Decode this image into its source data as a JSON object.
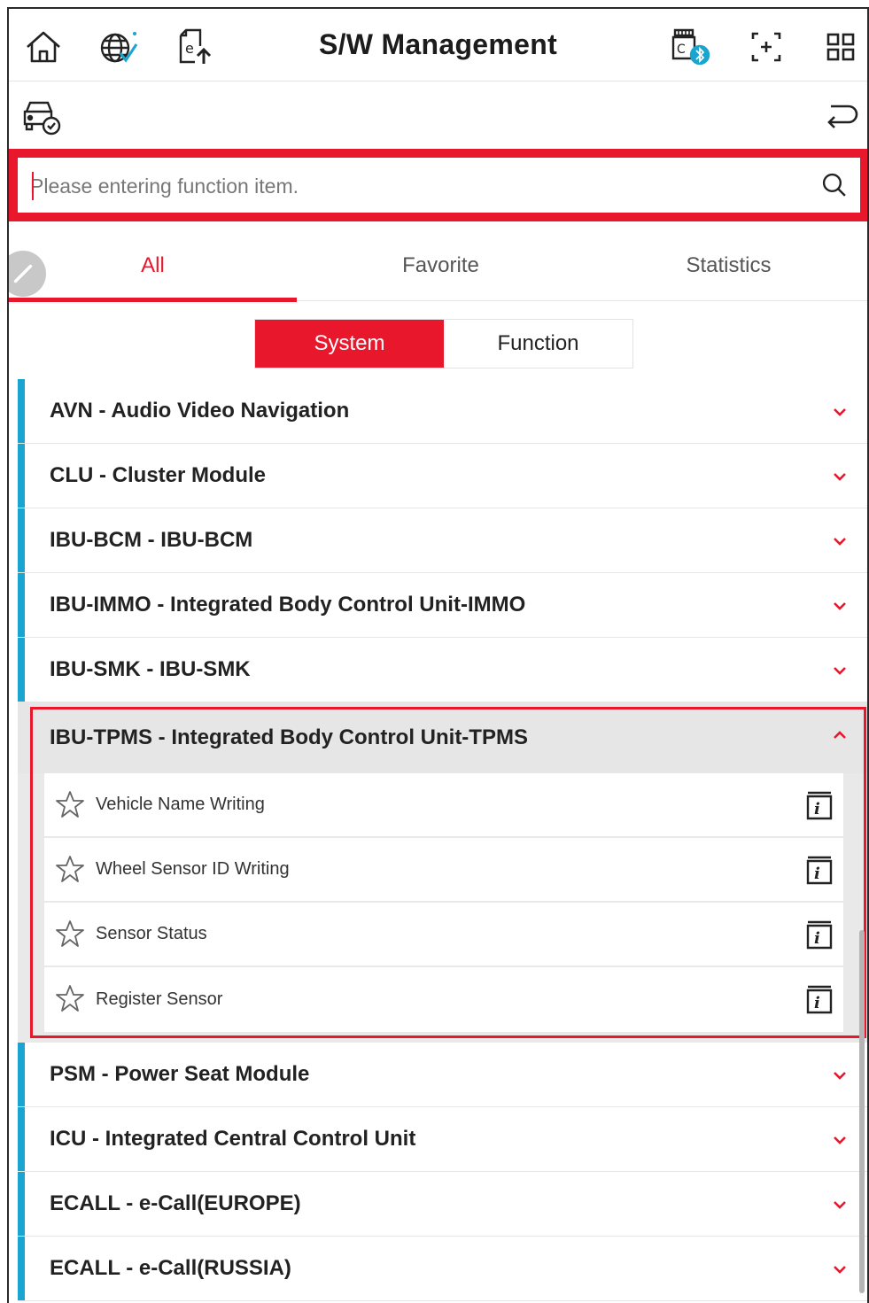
{
  "header": {
    "title": "S/W Management",
    "icons": [
      "home-icon",
      "globe-check-icon",
      "e-upload-icon",
      "vci-bluetooth-icon",
      "screenshot-icon",
      "grid-menu-icon"
    ]
  },
  "subbar": {
    "icons": [
      "vehicle-check-icon",
      "return-icon"
    ]
  },
  "search": {
    "placeholder": "Please entering function item."
  },
  "tabs": [
    {
      "label": "All",
      "active": true
    },
    {
      "label": "Favorite",
      "active": false
    },
    {
      "label": "Statistics",
      "active": false
    }
  ],
  "segment": [
    {
      "label": "System",
      "active": true
    },
    {
      "label": "Function",
      "active": false
    }
  ],
  "systems": [
    {
      "label": "AVN - Audio Video Navigation"
    },
    {
      "label": "CLU - Cluster Module"
    },
    {
      "label": "IBU-BCM - IBU-BCM"
    },
    {
      "label": "IBU-IMMO - Integrated Body Control Unit-IMMO"
    },
    {
      "label": "IBU-SMK - IBU-SMK"
    },
    {
      "label": "IBU-TPMS - Integrated Body Control Unit-TPMS",
      "expanded": true,
      "functions": [
        {
          "label": "Vehicle Name Writing"
        },
        {
          "label": "Wheel Sensor ID Writing"
        },
        {
          "label": "Sensor Status"
        },
        {
          "label": "Register Sensor"
        }
      ]
    },
    {
      "label": "PSM - Power Seat Module"
    },
    {
      "label": "ICU - Integrated Central Control Unit"
    },
    {
      "label": "ECALL - e-Call(EUROPE)"
    },
    {
      "label": "ECALL - e-Call(RUSSIA)"
    }
  ],
  "colors": {
    "accent": "#e8172c",
    "system_bar": "#19a5cf",
    "expanded_bg": "#e6e6e6"
  }
}
